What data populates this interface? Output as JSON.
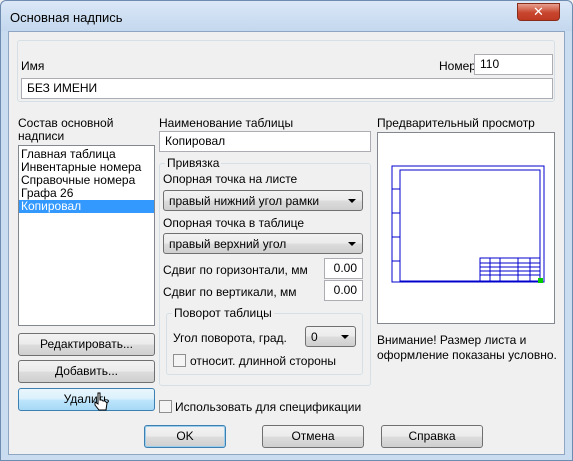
{
  "window": {
    "title": "Основная надпись",
    "close_glyph": "✕"
  },
  "name_field": {
    "label": "Имя",
    "value": "БЕЗ ИМЕНИ"
  },
  "number_field": {
    "label": "Номер",
    "value": "110"
  },
  "composition": {
    "label_line1": "Состав основной",
    "label_line2": "надписи",
    "items": [
      "Главная таблица",
      "Инвентарные номера",
      "Справочные номера",
      "Графа 26",
      "Копировал"
    ],
    "selected_index": 4
  },
  "table_name": {
    "label": "Наименование таблицы",
    "value": "Копировал"
  },
  "binding": {
    "group_label": "Привязка",
    "sheet_point_label": "Опорная точка на листе",
    "sheet_point_value": "правый нижний угол рамки",
    "table_point_label": "Опорная точка в таблице",
    "table_point_value": "правый верхний угол",
    "shift_h_label": "Сдвиг по горизонтали, мм",
    "shift_h_value": "0.00",
    "shift_v_label": "Сдвиг по вертикали, мм",
    "shift_v_value": "0.00"
  },
  "rotation": {
    "group_label": "Поворот таблицы",
    "angle_label": "Угол поворота, град.",
    "angle_value": "0",
    "relative_label": "относит. длинной стороны"
  },
  "preview": {
    "label": "Предварительный просмотр",
    "note": "Внимание! Размер листа и оформление показаны условно."
  },
  "buttons": {
    "edit": "Редактировать...",
    "add": "Добавить...",
    "delete": "Удалить",
    "ok": "OK",
    "cancel": "Отмена",
    "help": "Справка"
  },
  "use_for_spec": {
    "label": "Использовать для спецификации"
  },
  "colors": {
    "frame_blue": "#0000cc",
    "marker_green": "#00cc00",
    "selection": "#3399ff"
  }
}
